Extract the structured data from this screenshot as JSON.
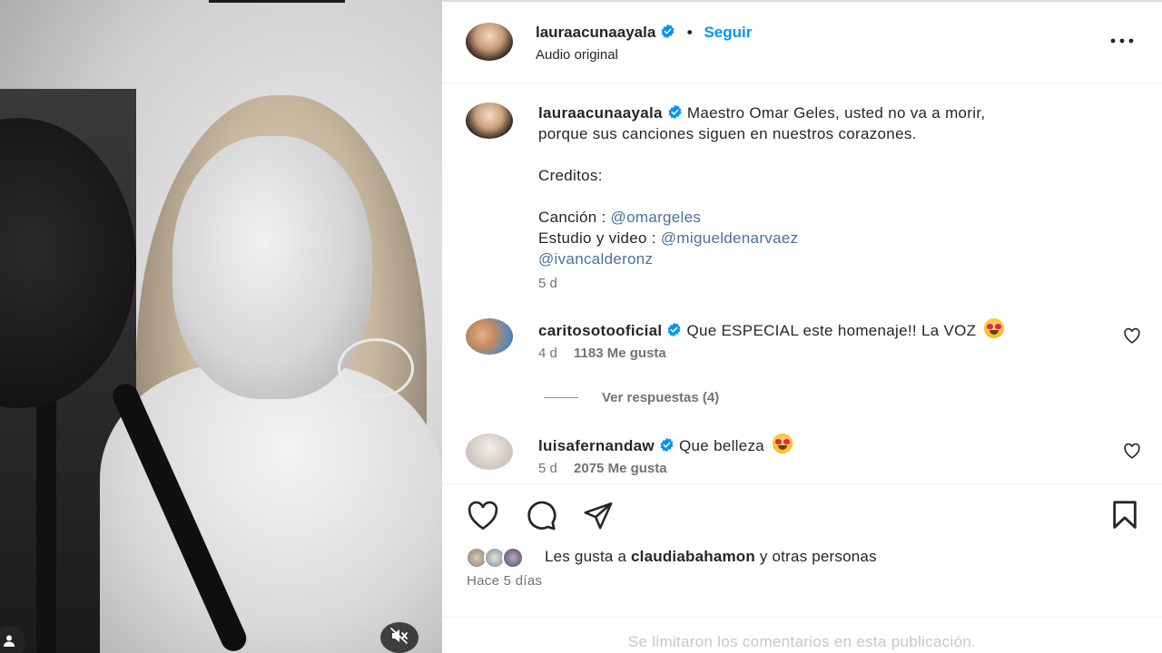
{
  "post": {
    "author": "lauraacunaayala",
    "follow_label": "Seguir",
    "separator": "•",
    "audio_label": "Audio original",
    "more_label": "•••"
  },
  "caption": {
    "username": "lauraacunaayala",
    "text_line1": "Maestro Omar Geles, usted no va a morir,",
    "text_line2": "porque sus canciones siguen en nuestros corazones.",
    "credits_label": "Creditos:",
    "song_label": "Canción : ",
    "song_mention": "@omargeles",
    "studio_label": "Estudio y video : ",
    "studio_mention": "@migueldenarvaez",
    "video_mention": "@ivancalderonz",
    "time": "5 d"
  },
  "comments": [
    {
      "username": "caritosotooficial",
      "text": "Que ESPECIAL este homenaje!! La VOZ",
      "time": "4 d",
      "likes": "1183 Me gusta",
      "emoji": "heart-eyes-emoji"
    },
    {
      "username": "luisafernandaw",
      "text": "Que belleza",
      "time": "5 d",
      "likes": "2075 Me gusta",
      "emoji": "heart-eyes-emoji"
    }
  ],
  "replies": {
    "label": "Ver respuestas (4)"
  },
  "likes_summary": {
    "prefix": "Les gusta a ",
    "user": "claudiabahamon",
    "suffix": " y otras personas"
  },
  "posted": "Hace 5 días",
  "limited_notice": "Se limitaron los comentarios en esta publicación.",
  "icons": [
    "heart-icon",
    "comment-icon",
    "share-icon",
    "bookmark-icon",
    "more-options-icon",
    "verified-badge-icon",
    "mute-icon",
    "account-icon"
  ],
  "colors": {
    "link": "#0095f6",
    "verified": "#0095f6",
    "text": "#262626",
    "muted": "#737373",
    "mention": "#4a6fa5"
  }
}
